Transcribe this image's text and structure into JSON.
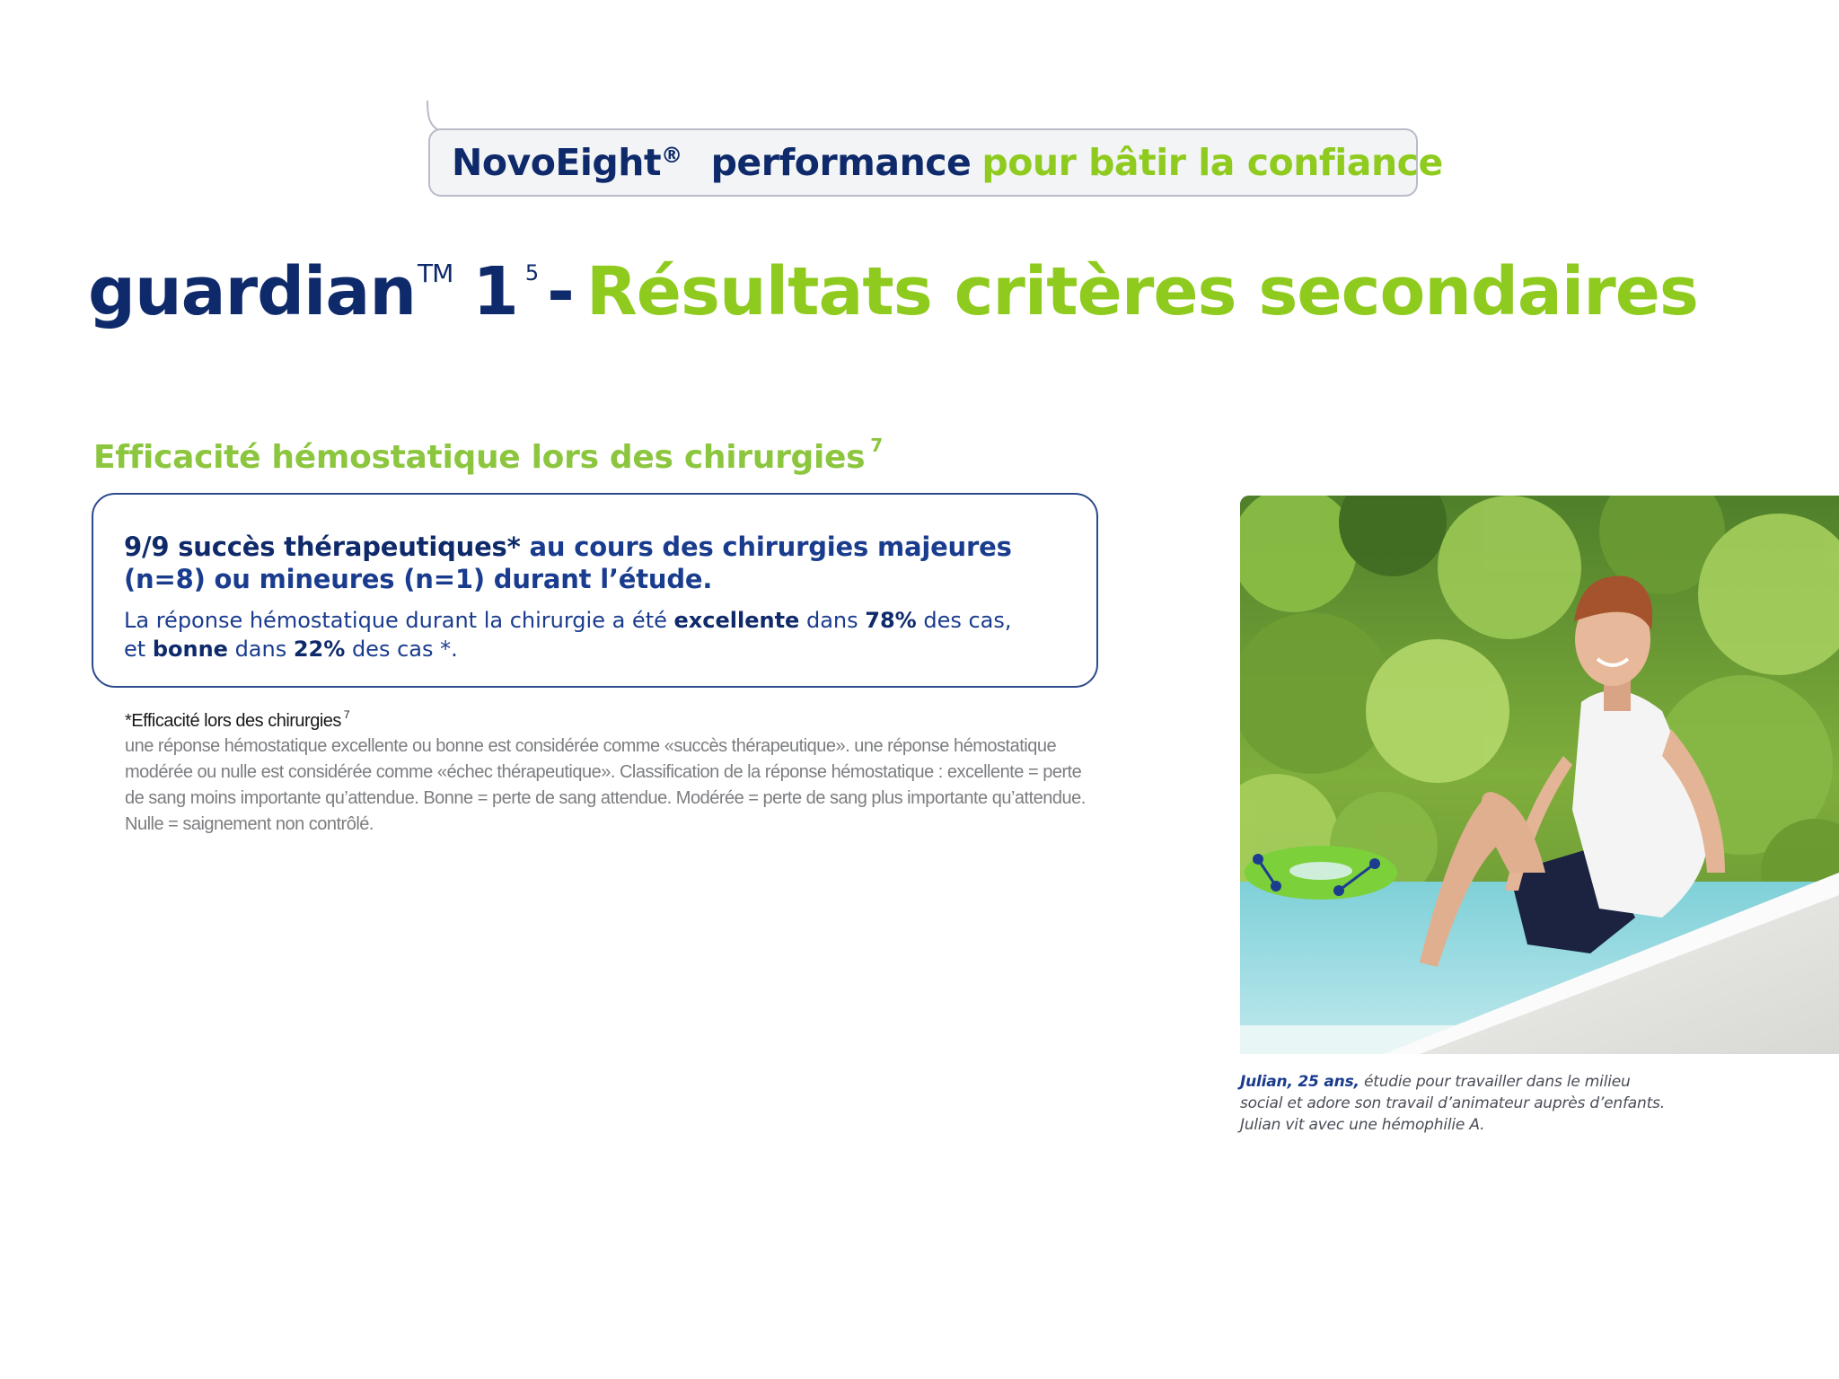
{
  "header": {
    "brand": "NovoEight",
    "brand_reg": "®",
    "tagline_dark": "performance",
    "tagline_green": "pour bâtir la confiance"
  },
  "title": {
    "brand": "guardian",
    "tm": "TM",
    "number": "1",
    "ref": "5",
    "dash": "-",
    "text": "Résultats critères secondaires"
  },
  "section": {
    "heading": "Efficacité hémostatique lors des chirurgies",
    "heading_ref": "7"
  },
  "result": {
    "main_strong": "9/9 succès thérapeutiques*",
    "main_rest": " au cours des chirurgies majeures (n=8) ou mineures (n=1) durant l’étude.",
    "sub_1": "La réponse hémostatique durant la chirurgie a été ",
    "sub_b1": "excellente",
    "sub_2": " dans ",
    "sub_b2": "78%",
    "sub_3": " des cas,",
    "sub_4": "et ",
    "sub_b3": "bonne",
    "sub_5": " dans ",
    "sub_b4": "22%",
    "sub_6": " des cas *."
  },
  "footnote": {
    "title": "*Efficacité lors des chirurgies",
    "title_ref": "7",
    "body": "une réponse hémostatique excellente ou bonne est considérée comme «succès thérapeutique». une réponse hémostatique modérée ou nulle est considérée comme «échec thérapeutique». Classification de la réponse hémostatique : excellente = perte de sang moins importante qu’attendue. Bonne = perte de sang attendue. Modérée = perte de sang plus importante qu’attendue. Nulle = saignement non contrôlé."
  },
  "caption": {
    "name": "Julian, 25 ans,",
    "line_1": " étudie pour travailler dans le milieu",
    "line_2": "social et adore son travail d’animateur auprès d’enfants.",
    "line_3": "Julian vit avec une hémophilie A."
  },
  "colors": {
    "navy": "#0f2a6b",
    "green": "#8fcb1f",
    "grey_text": "#7b7d80"
  }
}
